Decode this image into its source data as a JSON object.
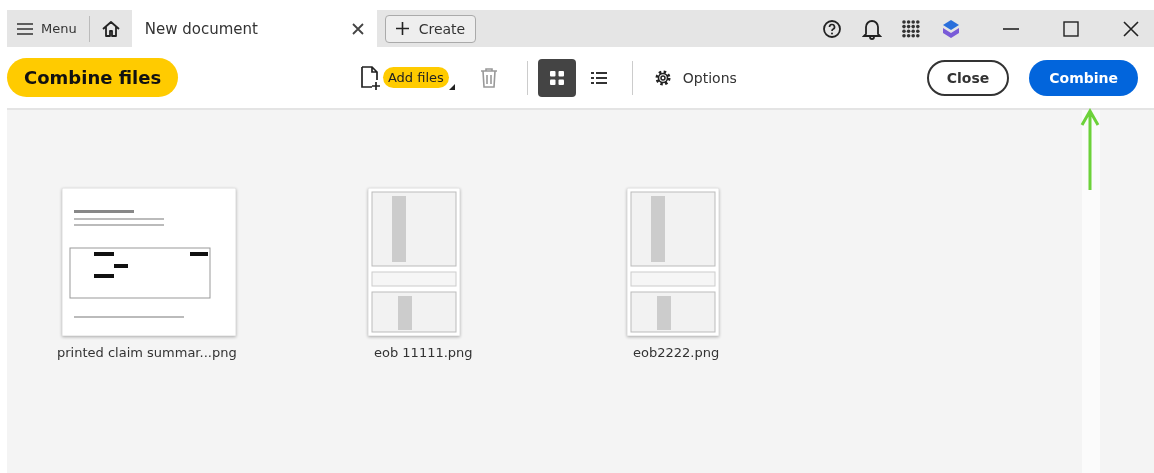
{
  "title_bar": {
    "menu": "Menu",
    "tabs": [
      {
        "label": "New document",
        "selected": true
      }
    ],
    "create": "Create"
  },
  "toolbar": {
    "title": "Combine files",
    "add_files": "Add files",
    "views": [
      {
        "kind": "grid",
        "selected": true
      },
      {
        "kind": "list",
        "selected": false
      }
    ],
    "options": "Options",
    "close": "Close",
    "combine": "Combine"
  },
  "files": [
    {
      "name": "printed claim summar...png",
      "kind": "letter"
    },
    {
      "name": "eob 11111.png",
      "kind": "table"
    },
    {
      "name": "eob2222.png",
      "kind": "table"
    }
  ]
}
